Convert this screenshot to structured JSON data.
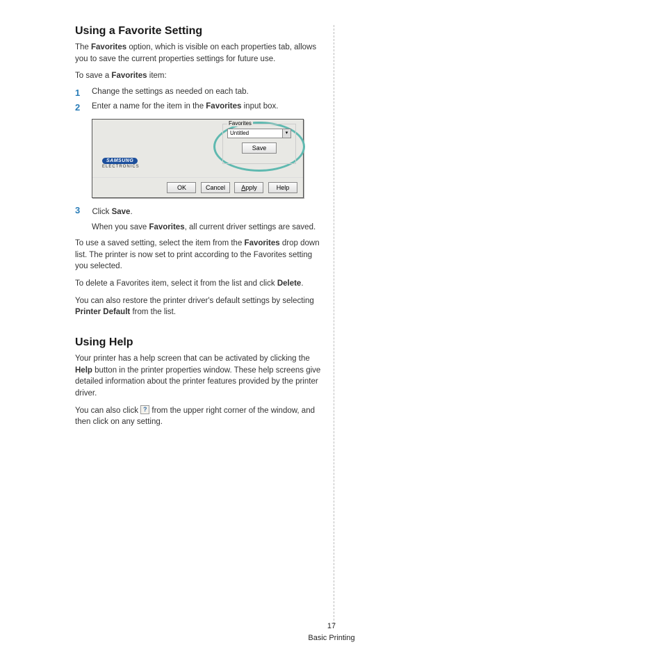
{
  "section1": {
    "heading": "Using a Favorite Setting",
    "intro_a": "The ",
    "intro_b": "Favorites",
    "intro_c": " option, which is visible on each properties tab, allows you to save the current properties settings for future use.",
    "save_lead_a": "To save a ",
    "save_lead_b": "Favorites",
    "save_lead_c": " item:",
    "step1_num": "1",
    "step1_text": "Change the settings as needed on each tab.",
    "step2_num": "2",
    "step2_a": "Enter a name for the item in the ",
    "step2_b": "Favorites",
    "step2_c": " input box.",
    "step3_num": "3",
    "step3_a": "Click ",
    "step3_b": "Save",
    "step3_c": ".",
    "step3_follow_a": "When you save ",
    "step3_follow_b": "Favorites",
    "step3_follow_c": ", all current driver settings are saved.",
    "use_a": "To use a saved setting, select the item from the ",
    "use_b": "Favorites",
    "use_c": " drop down list. The printer is now set to print according to the Favorites setting you selected.",
    "delete_a": "To delete a Favorites item, select it from the list and click ",
    "delete_b": "Delete",
    "delete_c": ".",
    "restore_a": "You can also restore the printer driver's default settings by selecting ",
    "restore_b": "Printer Default",
    "restore_c": " from the list."
  },
  "dialog": {
    "legend": "Favorites",
    "select_value": "Untitled",
    "save": "Save",
    "ok": "OK",
    "cancel": "Cancel",
    "apply_u": "A",
    "apply_rest": "pply",
    "help": "Help",
    "logo_text": "SAMSUNG",
    "logo_sub": "ELECTRONICS",
    "arrow": "▾"
  },
  "section2": {
    "heading": "Using Help",
    "p1_a": "Your printer has a help screen that can be activated by clicking the ",
    "p1_b": "Help",
    "p1_c": " button in the printer properties window. These help screens give detailed information about the printer features provided by the printer driver.",
    "p2_a": "You can also click ",
    "p2_icon": "?",
    "p2_b": " from the upper right corner of the window, and then click on any setting."
  },
  "footer": {
    "page": "17",
    "section": "Basic Printing"
  }
}
